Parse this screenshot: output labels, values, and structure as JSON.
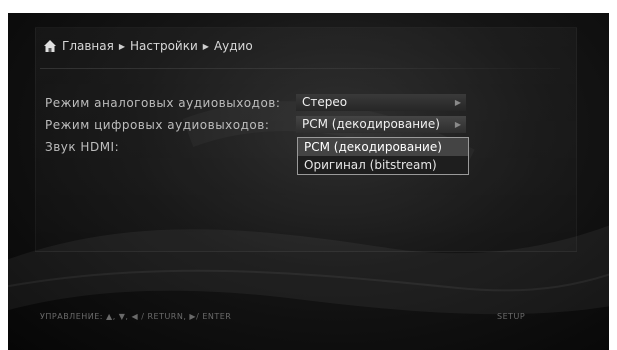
{
  "breadcrumb": {
    "home": "Главная",
    "settings": "Настройки",
    "audio": "Аудио",
    "separator": "▶"
  },
  "settings": [
    {
      "label": "Режим аналоговых аудиовыходов:",
      "value": "Стерео"
    },
    {
      "label": "Режим цифровых аудиовыходов:",
      "value": "PCM (декодирование)"
    },
    {
      "label": "Звук HDMI:"
    }
  ],
  "dropdown": {
    "options": [
      "PCM (декодирование)",
      "Оригинал (bitstream)"
    ],
    "selected_index": 0
  },
  "footer": {
    "controls": "УПРАВЛЕНИЕ:  ▲, ▼,  ◀ / RETURN,  ▶/ ENTER",
    "menu": "SETUP"
  },
  "colors": {
    "background": "#0a0a0a",
    "highlight": "#444444",
    "text": "#e6e6e6"
  },
  "icons": {
    "home": "home-icon",
    "arrow": "arrow-right-icon"
  }
}
